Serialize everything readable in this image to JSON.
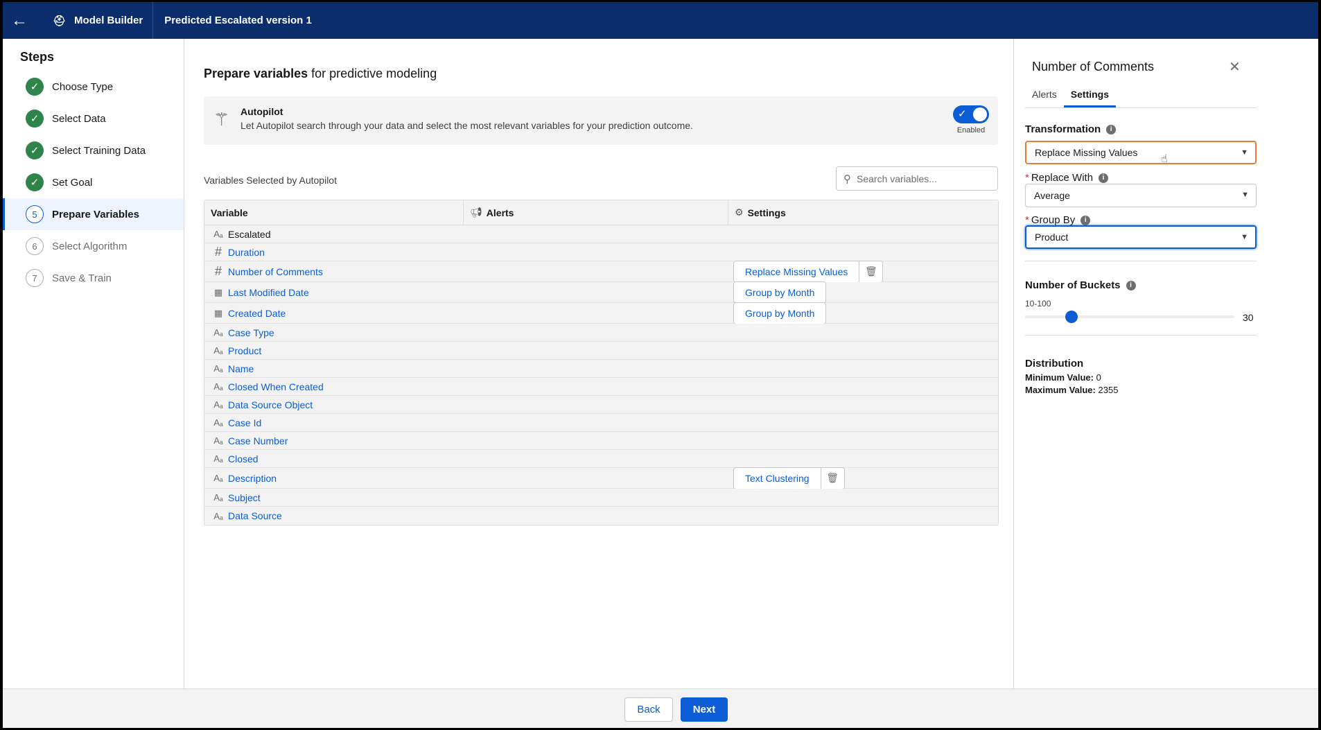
{
  "topbar": {
    "app_title": "Model Builder",
    "model_title": "Predicted Escalated version 1"
  },
  "steps": {
    "heading": "Steps",
    "items": [
      {
        "label": "Choose Type",
        "state": "done",
        "number": "1"
      },
      {
        "label": "Select Data",
        "state": "done",
        "number": "2"
      },
      {
        "label": "Select Training Data",
        "state": "done",
        "number": "3"
      },
      {
        "label": "Set Goal",
        "state": "done",
        "number": "4"
      },
      {
        "label": "Prepare Variables",
        "state": "active",
        "number": "5"
      },
      {
        "label": "Select Algorithm",
        "state": "todo",
        "number": "6"
      },
      {
        "label": "Save & Train",
        "state": "todo",
        "number": "7"
      }
    ]
  },
  "main": {
    "heading_bold": "Prepare variables",
    "heading_rest": " for predictive modeling",
    "autopilot": {
      "title": "Autopilot",
      "description": "Let Autopilot search through your data and select the most relevant variables for your prediction outcome.",
      "toggle_label": "Enabled",
      "enabled": true
    },
    "vars_caption": "Variables Selected by Autopilot",
    "search": {
      "placeholder": "Search variables..."
    },
    "table": {
      "headers": {
        "variable": "Variable",
        "alerts": "Alerts",
        "settings": "Settings"
      },
      "rows": [
        {
          "type": "text",
          "name": "Escalated",
          "link": false,
          "setting": "",
          "removable": false
        },
        {
          "type": "number",
          "name": "Duration",
          "link": true,
          "setting": "",
          "removable": false
        },
        {
          "type": "number",
          "name": "Number of Comments",
          "link": true,
          "setting": "Replace Missing Values",
          "removable": true
        },
        {
          "type": "date",
          "name": "Last Modified Date",
          "link": true,
          "setting": "Group by Month",
          "removable": false
        },
        {
          "type": "date",
          "name": "Created Date",
          "link": true,
          "setting": "Group by Month",
          "removable": false
        },
        {
          "type": "text",
          "name": "Case Type",
          "link": true,
          "setting": "",
          "removable": false
        },
        {
          "type": "text",
          "name": "Product",
          "link": true,
          "setting": "",
          "removable": false
        },
        {
          "type": "text",
          "name": "Name",
          "link": true,
          "setting": "",
          "removable": false
        },
        {
          "type": "text",
          "name": "Closed When Created",
          "link": true,
          "setting": "",
          "removable": false
        },
        {
          "type": "text",
          "name": "Data Source Object",
          "link": true,
          "setting": "",
          "removable": false
        },
        {
          "type": "text",
          "name": "Case Id",
          "link": true,
          "setting": "",
          "removable": false
        },
        {
          "type": "text",
          "name": "Case Number",
          "link": true,
          "setting": "",
          "removable": false
        },
        {
          "type": "text",
          "name": "Closed",
          "link": true,
          "setting": "",
          "removable": false
        },
        {
          "type": "text",
          "name": "Description",
          "link": true,
          "setting": "Text Clustering",
          "removable": true
        },
        {
          "type": "text",
          "name": "Subject",
          "link": true,
          "setting": "",
          "removable": false
        },
        {
          "type": "text",
          "name": "Data Source",
          "link": true,
          "setting": "",
          "removable": false
        }
      ]
    }
  },
  "panel": {
    "title": "Number of Comments",
    "tabs": [
      {
        "label": "Alerts",
        "selected": false
      },
      {
        "label": "Settings",
        "selected": true
      }
    ],
    "transformation": {
      "label": "Transformation",
      "value": "Replace Missing Values"
    },
    "replace_with": {
      "label": "Replace With",
      "value": "Average"
    },
    "group_by": {
      "label": "Group By",
      "value": "Product"
    },
    "buckets": {
      "label": "Number of Buckets",
      "range": "10-100",
      "min": 10,
      "max": 100,
      "value": 30,
      "value_text": "30"
    },
    "distribution": {
      "title": "Distribution",
      "min_label": "Minimum Value:",
      "min_value": "0",
      "max_label": "Maximum Value:",
      "max_value": "2355"
    }
  },
  "footer": {
    "back_label": "Back",
    "next_label": "Next"
  },
  "colors": {
    "brand_nav": "#0b2d6b",
    "accent": "#0b5cd5",
    "success": "#2e844a",
    "focus_orange": "#e77e2f"
  }
}
